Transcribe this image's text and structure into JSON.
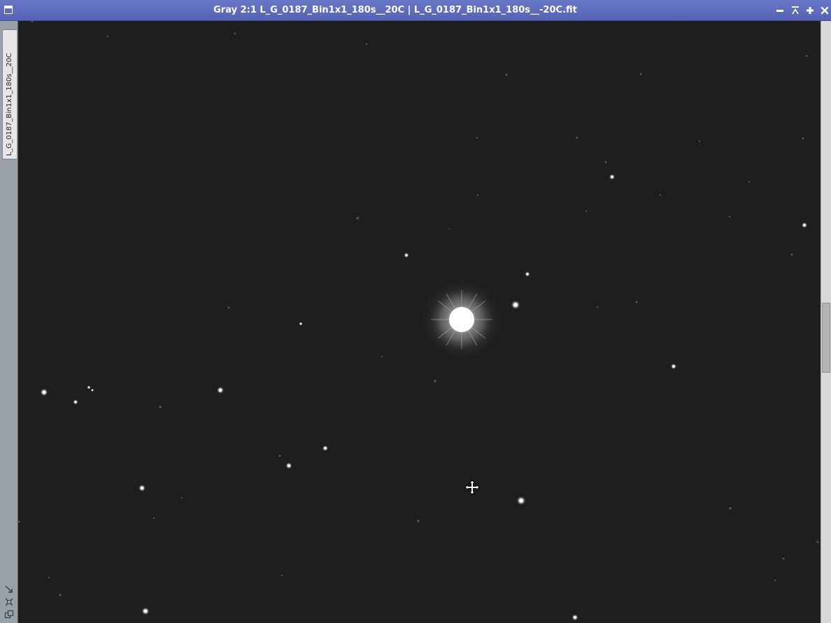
{
  "window": {
    "title": "Gray 2:1 L_G_0187_Bin1x1_180s__20C | L_G_0187_Bin1x1_180s__-20C.fit",
    "colors": {
      "titlebar": "#5a68b8",
      "title_text": "#ffffff",
      "background": "#1e1e1e"
    },
    "controls": [
      {
        "name": "minimize",
        "icon": "minus-icon"
      },
      {
        "name": "shade",
        "icon": "shade-icon"
      },
      {
        "name": "maximize",
        "icon": "plus-icon"
      },
      {
        "name": "close",
        "icon": "close-icon"
      }
    ]
  },
  "view_tab": {
    "label": "L_G_0187_Bin1x1_180s__20C"
  },
  "left_tools": [
    "zoom-to-fit-icon",
    "fit-view-icon",
    "clone-view-icon"
  ],
  "image": {
    "description_icon": "star-field",
    "cursor": "pan-move-icon",
    "scroll_position": 0.53
  }
}
